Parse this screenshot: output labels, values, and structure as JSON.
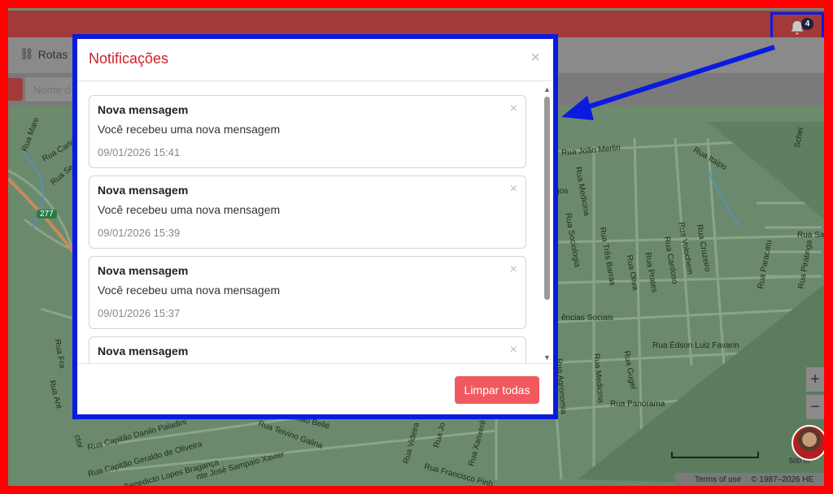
{
  "header": {
    "notification_icon": "bell-icon",
    "notification_count": "4"
  },
  "nav": {
    "rotas_icon": "route-icon",
    "rotas_label": "Rotas"
  },
  "search": {
    "placeholder": "Nome d"
  },
  "map": {
    "streets": [
      "Rua Mare",
      "Rua Carlo",
      "Rua Se",
      "Rua João Merlin",
      "Rua Itaipu",
      "Rua Medicina",
      "igos",
      "Rua Sociologia",
      "Rua Três Barras",
      "Rua Oliva",
      "Rua Prates",
      "Rua Cardoso",
      "Rua Volochem",
      "Rua Cruzeiro",
      "Rua Paracatu",
      "Rua Piratinga",
      "Rua Sa",
      "ências Sociais",
      "Rua Édson Luiz Favarin",
      "Rua Agronomia",
      "Rua Medicina",
      "Rua Gugel",
      "Rua Panorama",
      "Rua Fra",
      "Rua Ant",
      "ctor",
      "Rua Capitão Danilo Paladini",
      "Rua Capitão Geraldo de Oliveira",
      "Rua Benedicto Lopes Bragança",
      "nte José Sampaio Xavier",
      "Rua Teivino Galina",
      "aldino João Bellé",
      "Rua Videira",
      "Rua Jo",
      "Rua Xanxerê",
      "Rua Francisco Pinh",
      "Schei",
      "277"
    ],
    "scale": "500 m",
    "terms": "Terms of use",
    "copyright": "© 1987–2026 HE",
    "zoom_in": "+",
    "zoom_out": "−"
  },
  "modal": {
    "title": "Notificações",
    "close_icon": "close-icon",
    "notifications": [
      {
        "title": "Nova mensagem",
        "message": "Você recebeu uma nova mensagem",
        "time": "09/01/2026 15:41"
      },
      {
        "title": "Nova mensagem",
        "message": "Você recebeu uma nova mensagem",
        "time": "09/01/2026 15:39"
      },
      {
        "title": "Nova mensagem",
        "message": "Você recebeu uma nova mensagem",
        "time": "09/01/2026 15:37"
      },
      {
        "title": "Nova mensagem",
        "message": "",
        "time": ""
      }
    ],
    "clear_all_label": "Limpar todas"
  },
  "colors": {
    "annotation": "#0a1be0",
    "frame": "#ff0000",
    "brand": "#d0202a",
    "button": "#f05a5f"
  }
}
